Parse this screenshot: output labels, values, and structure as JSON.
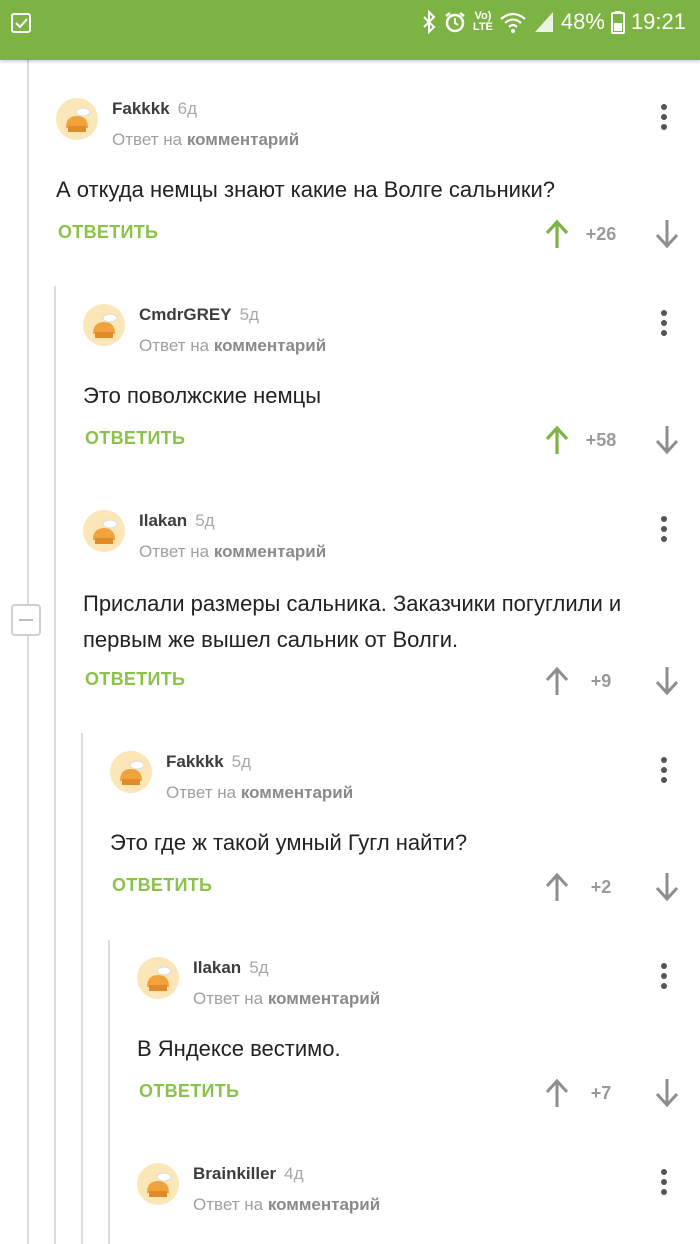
{
  "status_bar": {
    "battery": "48%",
    "time": "19:21",
    "network_label_top": "Vo)",
    "network_label_bottom": "LTE",
    "icons": [
      "checkbox-notification-icon",
      "bluetooth-icon",
      "alarm-icon",
      "volte-icon",
      "wifi-icon",
      "signal-icon",
      "battery-icon"
    ]
  },
  "ui": {
    "reply_label": "ОТВЕТИТЬ",
    "reply_to_prefix": "Ответ на",
    "reply_to_target": "комментарий"
  },
  "colors": {
    "accent": "#7cb342",
    "upvote_active": "#7cb342",
    "upvote_inactive": "#8e8e8e"
  },
  "comments": [
    {
      "author": "Fakkkk",
      "age": "6д",
      "text": "А откуда немцы знают какие на Волге сальники?",
      "score": "+26",
      "upvoted": true
    },
    {
      "author": "CmdrGREY",
      "age": "5д",
      "text": "Это поволжские немцы",
      "score": "+58",
      "upvoted": true
    },
    {
      "author": "Ilakan",
      "age": "5д",
      "text": "Прислали размеры сальника. Заказчики погуглили и первым же вышел сальник от Волги.",
      "score": "+9",
      "upvoted": false
    },
    {
      "author": "Fakkkk",
      "age": "5д",
      "text": "Это где ж такой умный Гугл найти?",
      "score": "+2",
      "upvoted": false
    },
    {
      "author": "Ilakan",
      "age": "5д",
      "text": "В Яндексе вестимо.",
      "score": "+7",
      "upvoted": false
    },
    {
      "author": "Brainkiller",
      "age": "4д",
      "text": "",
      "score": "",
      "upvoted": false
    }
  ]
}
